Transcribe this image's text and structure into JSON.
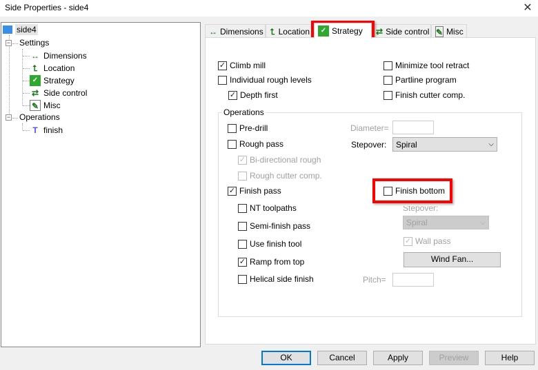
{
  "window": {
    "title": "Side Properties - side4",
    "close": "✕"
  },
  "tree": {
    "root": "side4",
    "settings": "Settings",
    "items": [
      "Dimensions",
      "Location",
      "Strategy",
      "Side control",
      "Misc"
    ],
    "operations": "Operations",
    "op_items": [
      "finish"
    ]
  },
  "tabs": [
    "Dimensions",
    "Location",
    "Strategy",
    "Side control",
    "Misc"
  ],
  "strategy": {
    "climb_mill": "Climb mill",
    "individual_rough": "Individual rough levels",
    "depth_first": "Depth first",
    "minimize_retract": "Minimize tool retract",
    "partline": "Partline program",
    "finish_cutter_comp": "Finish cutter comp.",
    "operations_group": "Operations",
    "pre_drill": "Pre-drill",
    "rough_pass": "Rough pass",
    "bi_directional": "Bi-directional rough",
    "rough_cutter_comp": "Rough cutter comp.",
    "finish_pass": "Finish pass",
    "nt_toolpaths": "NT toolpaths",
    "semi_finish": "Semi-finish pass",
    "use_finish_tool": "Use finish tool",
    "ramp_from_top": "Ramp from top",
    "helical": "Helical side finish",
    "diameter_label": "Diameter=",
    "diameter_value": "",
    "stepover_label": "Stepover:",
    "stepover_value": "Spiral",
    "finish_bottom": "Finish bottom",
    "stepover2_label": "Stepover:",
    "stepover2_value": "Spiral",
    "wall_pass": "Wall pass",
    "wind_fan": "Wind Fan...",
    "pitch_label": "Pitch=",
    "pitch_value": ""
  },
  "buttons": {
    "ok": "OK",
    "cancel": "Cancel",
    "apply": "Apply",
    "preview": "Preview",
    "help": "Help"
  },
  "colors": {
    "highlight": "#ff0000",
    "green": "#1a7a1a"
  }
}
